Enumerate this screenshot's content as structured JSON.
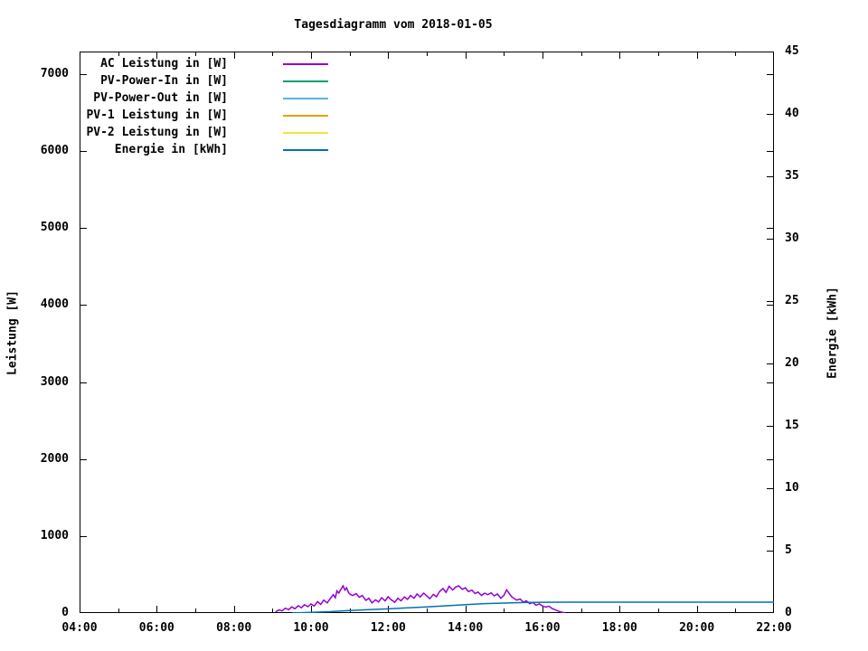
{
  "chart_data": {
    "type": "line",
    "title": "Tagesdiagramm vom 2018-01-05",
    "x_axis": {
      "min_hour": 4,
      "max_hour": 22,
      "major_ticks": [
        {
          "hour": 4,
          "label": "04:00"
        },
        {
          "hour": 6,
          "label": "06:00"
        },
        {
          "hour": 8,
          "label": "08:00"
        },
        {
          "hour": 10,
          "label": "10:00"
        },
        {
          "hour": 12,
          "label": "12:00"
        },
        {
          "hour": 14,
          "label": "14:00"
        },
        {
          "hour": 16,
          "label": "16:00"
        },
        {
          "hour": 18,
          "label": "18:00"
        },
        {
          "hour": 20,
          "label": "20:00"
        },
        {
          "hour": 22,
          "label": "22:00"
        }
      ],
      "minor_hours": [
        5,
        7,
        9,
        11,
        13,
        15,
        17,
        19,
        21
      ]
    },
    "y_left": {
      "label": "Leistung [W]",
      "min": 0,
      "max": 7294,
      "tick_step": 1000,
      "ticks": [
        {
          "v": 0,
          "label": "0"
        },
        {
          "v": 1000,
          "label": "1000"
        },
        {
          "v": 2000,
          "label": "2000"
        },
        {
          "v": 3000,
          "label": "3000"
        },
        {
          "v": 4000,
          "label": "4000"
        },
        {
          "v": 5000,
          "label": "5000"
        },
        {
          "v": 6000,
          "label": "6000"
        },
        {
          "v": 7000,
          "label": "7000"
        }
      ]
    },
    "y_right": {
      "label": "Energie [kWh]",
      "min": 0,
      "max": 45,
      "tick_step": 5,
      "ticks": [
        {
          "v": 0,
          "label": "0"
        },
        {
          "v": 5,
          "label": "5"
        },
        {
          "v": 10,
          "label": "10"
        },
        {
          "v": 15,
          "label": "15"
        },
        {
          "v": 20,
          "label": "20"
        },
        {
          "v": 25,
          "label": "25"
        },
        {
          "v": 30,
          "label": "30"
        },
        {
          "v": 35,
          "label": "35"
        },
        {
          "v": 40,
          "label": "40"
        },
        {
          "v": 45,
          "label": "45"
        }
      ]
    },
    "legend_position": "top-left-inside",
    "grid": false,
    "series": [
      {
        "name": "AC Leistung in [W]",
        "color": "#9400d3",
        "axis": "left",
        "points": [
          [
            9.08,
            15
          ],
          [
            9.17,
            40
          ],
          [
            9.25,
            28
          ],
          [
            9.33,
            62
          ],
          [
            9.42,
            45
          ],
          [
            9.5,
            80
          ],
          [
            9.58,
            55
          ],
          [
            9.67,
            95
          ],
          [
            9.75,
            68
          ],
          [
            9.83,
            108
          ],
          [
            9.92,
            82
          ],
          [
            10.0,
            118
          ],
          [
            10.08,
            92
          ],
          [
            10.17,
            148
          ],
          [
            10.25,
            112
          ],
          [
            10.33,
            168
          ],
          [
            10.42,
            132
          ],
          [
            10.5,
            188
          ],
          [
            10.58,
            238
          ],
          [
            10.63,
            198
          ],
          [
            10.67,
            288
          ],
          [
            10.72,
            258
          ],
          [
            10.78,
            312
          ],
          [
            10.83,
            352
          ],
          [
            10.88,
            298
          ],
          [
            10.92,
            328
          ],
          [
            10.97,
            268
          ],
          [
            11.0,
            248
          ],
          [
            11.08,
            228
          ],
          [
            11.17,
            252
          ],
          [
            11.25,
            205
          ],
          [
            11.33,
            228
          ],
          [
            11.42,
            165
          ],
          [
            11.5,
            192
          ],
          [
            11.58,
            132
          ],
          [
            11.67,
            172
          ],
          [
            11.75,
            145
          ],
          [
            11.83,
            198
          ],
          [
            11.92,
            158
          ],
          [
            12.0,
            212
          ],
          [
            12.08,
            172
          ],
          [
            12.17,
            140
          ],
          [
            12.25,
            192
          ],
          [
            12.33,
            158
          ],
          [
            12.42,
            208
          ],
          [
            12.5,
            178
          ],
          [
            12.58,
            228
          ],
          [
            12.67,
            192
          ],
          [
            12.75,
            248
          ],
          [
            12.83,
            208
          ],
          [
            12.92,
            258
          ],
          [
            13.0,
            222
          ],
          [
            13.08,
            185
          ],
          [
            13.17,
            242
          ],
          [
            13.25,
            212
          ],
          [
            13.33,
            278
          ],
          [
            13.42,
            318
          ],
          [
            13.5,
            268
          ],
          [
            13.58,
            348
          ],
          [
            13.67,
            298
          ],
          [
            13.75,
            338
          ],
          [
            13.83,
            352
          ],
          [
            13.92,
            308
          ],
          [
            14.0,
            328
          ],
          [
            14.08,
            278
          ],
          [
            14.17,
            298
          ],
          [
            14.25,
            252
          ],
          [
            14.33,
            272
          ],
          [
            14.42,
            228
          ],
          [
            14.5,
            258
          ],
          [
            14.58,
            238
          ],
          [
            14.67,
            262
          ],
          [
            14.75,
            222
          ],
          [
            14.83,
            248
          ],
          [
            14.92,
            192
          ],
          [
            15.0,
            228
          ],
          [
            15.07,
            302
          ],
          [
            15.13,
            258
          ],
          [
            15.2,
            212
          ],
          [
            15.33,
            168
          ],
          [
            15.42,
            182
          ],
          [
            15.5,
            142
          ],
          [
            15.58,
            158
          ],
          [
            15.67,
            122
          ],
          [
            15.75,
            138
          ],
          [
            15.83,
            102
          ],
          [
            15.92,
            118
          ],
          [
            16.0,
            92
          ],
          [
            16.08,
            78
          ],
          [
            16.17,
            88
          ],
          [
            16.25,
            58
          ],
          [
            16.33,
            42
          ],
          [
            16.42,
            22
          ],
          [
            16.5,
            10
          ],
          [
            16.58,
            3
          ]
        ]
      },
      {
        "name": "PV-Power-In in [W]",
        "color": "#009e73",
        "axis": "left",
        "points": []
      },
      {
        "name": "PV-Power-Out in [W]",
        "color": "#56b4e9",
        "axis": "left",
        "points": []
      },
      {
        "name": "PV-1 Leistung in [W]",
        "color": "#e69f00",
        "axis": "left",
        "points": []
      },
      {
        "name": "PV-2 Leistung in [W]",
        "color": "#f0e442",
        "axis": "left",
        "points": []
      },
      {
        "name": "Energie in [kWh]",
        "color": "#0072b2",
        "axis": "right",
        "points": [
          [
            9.5,
            0
          ],
          [
            10.0,
            0.05
          ],
          [
            10.5,
            0.11
          ],
          [
            11.0,
            0.2
          ],
          [
            11.5,
            0.27
          ],
          [
            12.0,
            0.33
          ],
          [
            12.5,
            0.41
          ],
          [
            13.0,
            0.49
          ],
          [
            13.5,
            0.58
          ],
          [
            14.0,
            0.67
          ],
          [
            14.5,
            0.75
          ],
          [
            15.0,
            0.8
          ],
          [
            15.5,
            0.84
          ],
          [
            16.0,
            0.86
          ],
          [
            16.6,
            0.87
          ],
          [
            22.0,
            0.87
          ]
        ]
      }
    ]
  }
}
